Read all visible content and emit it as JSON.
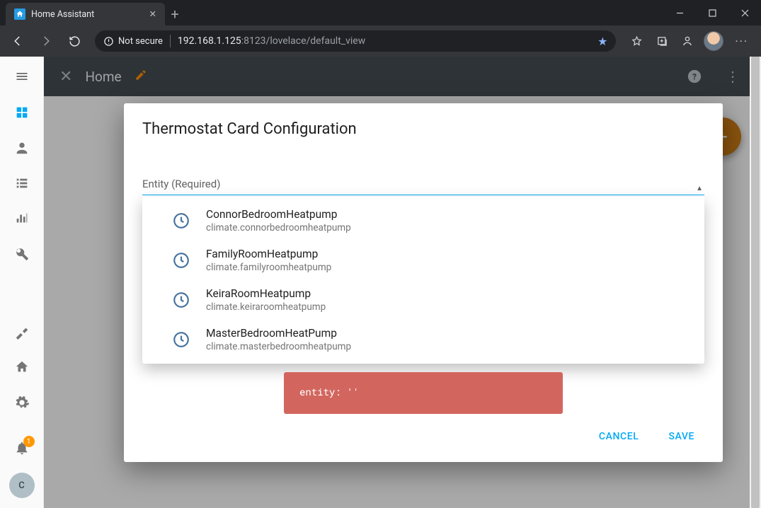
{
  "browser": {
    "tab_title": "Home Assistant",
    "url_insecure_label": "Not secure",
    "url_host": "192.168.1.125",
    "url_path": ":8123/lovelace/default_view"
  },
  "sidebar": {
    "notify_count": "1",
    "user_initial": "C"
  },
  "topbar": {
    "title": "Home"
  },
  "modal": {
    "title": "Thermostat Card Configuration",
    "field_label": "Entity (Required)",
    "options": [
      {
        "name": "ConnorBedroomHeatpump",
        "id": "climate.connorbedroomheatpump"
      },
      {
        "name": "FamilyRoomHeatpump",
        "id": "climate.familyroomheatpump"
      },
      {
        "name": "KeiraRoomHeatpump",
        "id": "climate.keiraroomheatpump"
      },
      {
        "name": "MasterBedroomHeatPump",
        "id": "climate.masterbedroomheatpump"
      }
    ],
    "code_snippet": "entity: ''",
    "cancel": "CANCEL",
    "save": "SAVE"
  }
}
